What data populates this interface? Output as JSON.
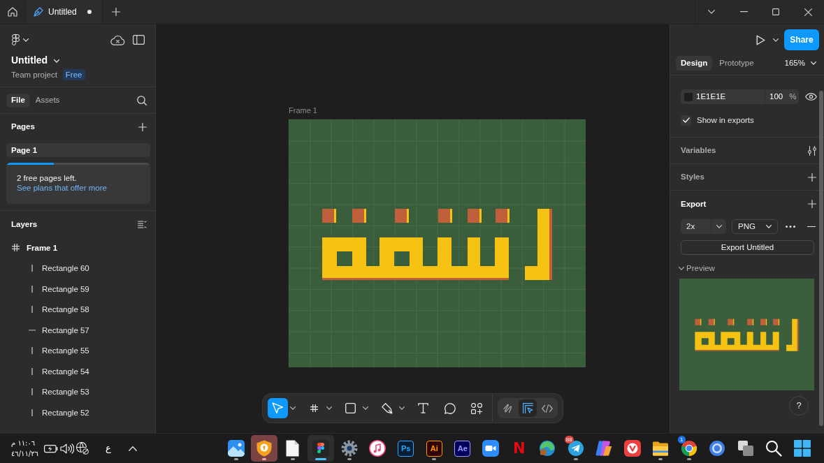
{
  "title_bar": {
    "file_tab": {
      "label": "Untitled",
      "unsaved": true
    }
  },
  "left_panel": {
    "file_name": "Untitled",
    "project": "Team project",
    "plan_badge": "Free",
    "tabs": [
      {
        "label": "File",
        "selected": true
      },
      {
        "label": "Assets",
        "selected": false
      }
    ],
    "pages": {
      "title": "Pages",
      "items": [
        {
          "label": "Page 1",
          "selected": true
        }
      ]
    },
    "notice": {
      "level": 0.33,
      "text": "2 free pages left.",
      "link": "See plans that offer more"
    },
    "layers": {
      "title": "Layers",
      "items": [
        {
          "label": "Frame 1",
          "kind": "frame",
          "children": [
            {
              "label": "Rectangle 60",
              "kind": "tall"
            },
            {
              "label": "Rectangle 59",
              "kind": "tall"
            },
            {
              "label": "Rectangle 58",
              "kind": "tall"
            },
            {
              "label": "Rectangle 57",
              "kind": "wide"
            },
            {
              "label": "Rectangle 55",
              "kind": "tall"
            },
            {
              "label": "Rectangle 54",
              "kind": "tall"
            },
            {
              "label": "Rectangle 53",
              "kind": "tall"
            },
            {
              "label": "Rectangle 52",
              "kind": "tall"
            }
          ]
        }
      ]
    }
  },
  "canvas": {
    "frame_label": "Frame 1",
    "toolbar": {
      "tools": [
        {
          "kind": "move",
          "selected": true,
          "dropdown": true
        },
        {
          "kind": "frame",
          "selected": false,
          "dropdown": true
        },
        {
          "kind": "shape",
          "selected": false,
          "dropdown": true
        },
        {
          "kind": "pen",
          "selected": false,
          "dropdown": true
        },
        {
          "kind": "text",
          "selected": false,
          "dropdown": false
        },
        {
          "kind": "comment",
          "selected": false,
          "dropdown": false
        },
        {
          "kind": "actions",
          "selected": false,
          "dropdown": false
        }
      ],
      "modes": [
        {
          "kind": "draw",
          "selected": false
        },
        {
          "kind": "design",
          "selected": true
        },
        {
          "kind": "dev",
          "selected": false
        }
      ]
    }
  },
  "right_panel": {
    "share": "Share",
    "tabs": [
      {
        "label": "Design",
        "selected": true
      },
      {
        "label": "Prototype",
        "selected": false
      }
    ],
    "zoom": "165%",
    "fill": {
      "hex": "1E1E1E",
      "opacity": "100",
      "unit": "%",
      "visible": true
    },
    "show_in_exports": {
      "label": "Show in exports",
      "checked": true
    },
    "sections": [
      {
        "label": "Variables",
        "kind": "variables",
        "active": false
      },
      {
        "label": "Styles",
        "kind": "styles",
        "active": false
      },
      {
        "label": "Export",
        "kind": "export",
        "active": true
      }
    ],
    "export": {
      "scale": "2x",
      "format": "PNG",
      "button": "Export Untitled",
      "preview": {
        "label": "Preview",
        "expanded": true
      }
    },
    "help": "?"
  },
  "taskbar": {
    "clock": {
      "time": "١١:٠٦ م",
      "date": "٤٦/١١/٢٦"
    },
    "tray": [
      {
        "kind": "battery"
      },
      {
        "kind": "volume"
      },
      {
        "kind": "network"
      }
    ],
    "language": "ع",
    "apps": [
      {
        "kind": "photos",
        "running": true,
        "active": false,
        "flashing": false
      },
      {
        "kind": "shield",
        "running": true,
        "active": false,
        "flashing": true
      },
      {
        "kind": "document",
        "running": true,
        "active": false,
        "flashing": false
      },
      {
        "kind": "figma",
        "running": true,
        "active": true,
        "flashing": false
      },
      {
        "kind": "settings",
        "running": true,
        "active": false,
        "flashing": false
      },
      {
        "kind": "music",
        "running": false,
        "active": false,
        "flashing": false
      },
      {
        "kind": "photoshop",
        "label": "Ps",
        "running": false,
        "active": false,
        "flashing": false
      },
      {
        "kind": "illustrator",
        "label": "Ai",
        "running": true,
        "active": false,
        "flashing": false
      },
      {
        "kind": "after-effects",
        "label": "Ae",
        "running": false,
        "active": false,
        "flashing": false
      },
      {
        "kind": "video-call",
        "running": false,
        "active": false,
        "flashing": false
      },
      {
        "kind": "netflix",
        "label": "N",
        "running": false,
        "active": false,
        "flashing": false
      },
      {
        "kind": "edge",
        "running": false,
        "active": false,
        "flashing": false
      },
      {
        "kind": "telegram",
        "badge": "88",
        "running": true,
        "active": false,
        "flashing": false
      },
      {
        "kind": "copilot",
        "running": false,
        "active": false,
        "flashing": false
      },
      {
        "kind": "vivaldi",
        "running": false,
        "active": false,
        "flashing": false
      },
      {
        "kind": "explorer",
        "running": true,
        "active": false,
        "flashing": false
      },
      {
        "kind": "chrome",
        "badge": "1",
        "running": true,
        "active": false,
        "flashing": false
      },
      {
        "kind": "ring-browser",
        "running": false,
        "active": false,
        "flashing": false
      },
      {
        "kind": "task-view",
        "running": false,
        "active": false,
        "flashing": false
      },
      {
        "kind": "search",
        "running": false,
        "active": false,
        "flashing": false
      },
      {
        "kind": "start",
        "running": false,
        "active": false,
        "flashing": false
      }
    ]
  }
}
